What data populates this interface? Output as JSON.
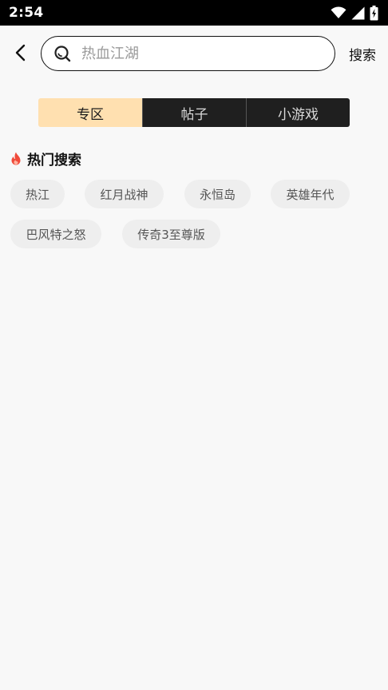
{
  "status_bar": {
    "time": "2:54",
    "icons": [
      "wifi-icon",
      "signal-icon",
      "battery-charging-icon"
    ]
  },
  "header": {
    "back_icon": "chevron-left-icon",
    "search": {
      "icon": "search-icon",
      "value": "",
      "placeholder": "热血江湖"
    },
    "search_button_label": "搜索"
  },
  "tabs": {
    "selected": "专区",
    "items": [
      {
        "label": "专区",
        "active": true
      },
      {
        "label": "帖子",
        "active": false
      },
      {
        "label": "小游戏",
        "active": false
      }
    ]
  },
  "hot_search": {
    "icon": "fire-icon",
    "title": "热门搜索",
    "items": [
      "热江",
      "红月战神",
      "永恒岛",
      "英雄年代",
      "巴风特之怒",
      "传奇3至尊版"
    ]
  },
  "colors": {
    "accent_tab": "#ffe0b0",
    "dark_tab": "#1f1f1f",
    "fire": "#f04a3a",
    "chip_bg": "#eeeeee"
  }
}
